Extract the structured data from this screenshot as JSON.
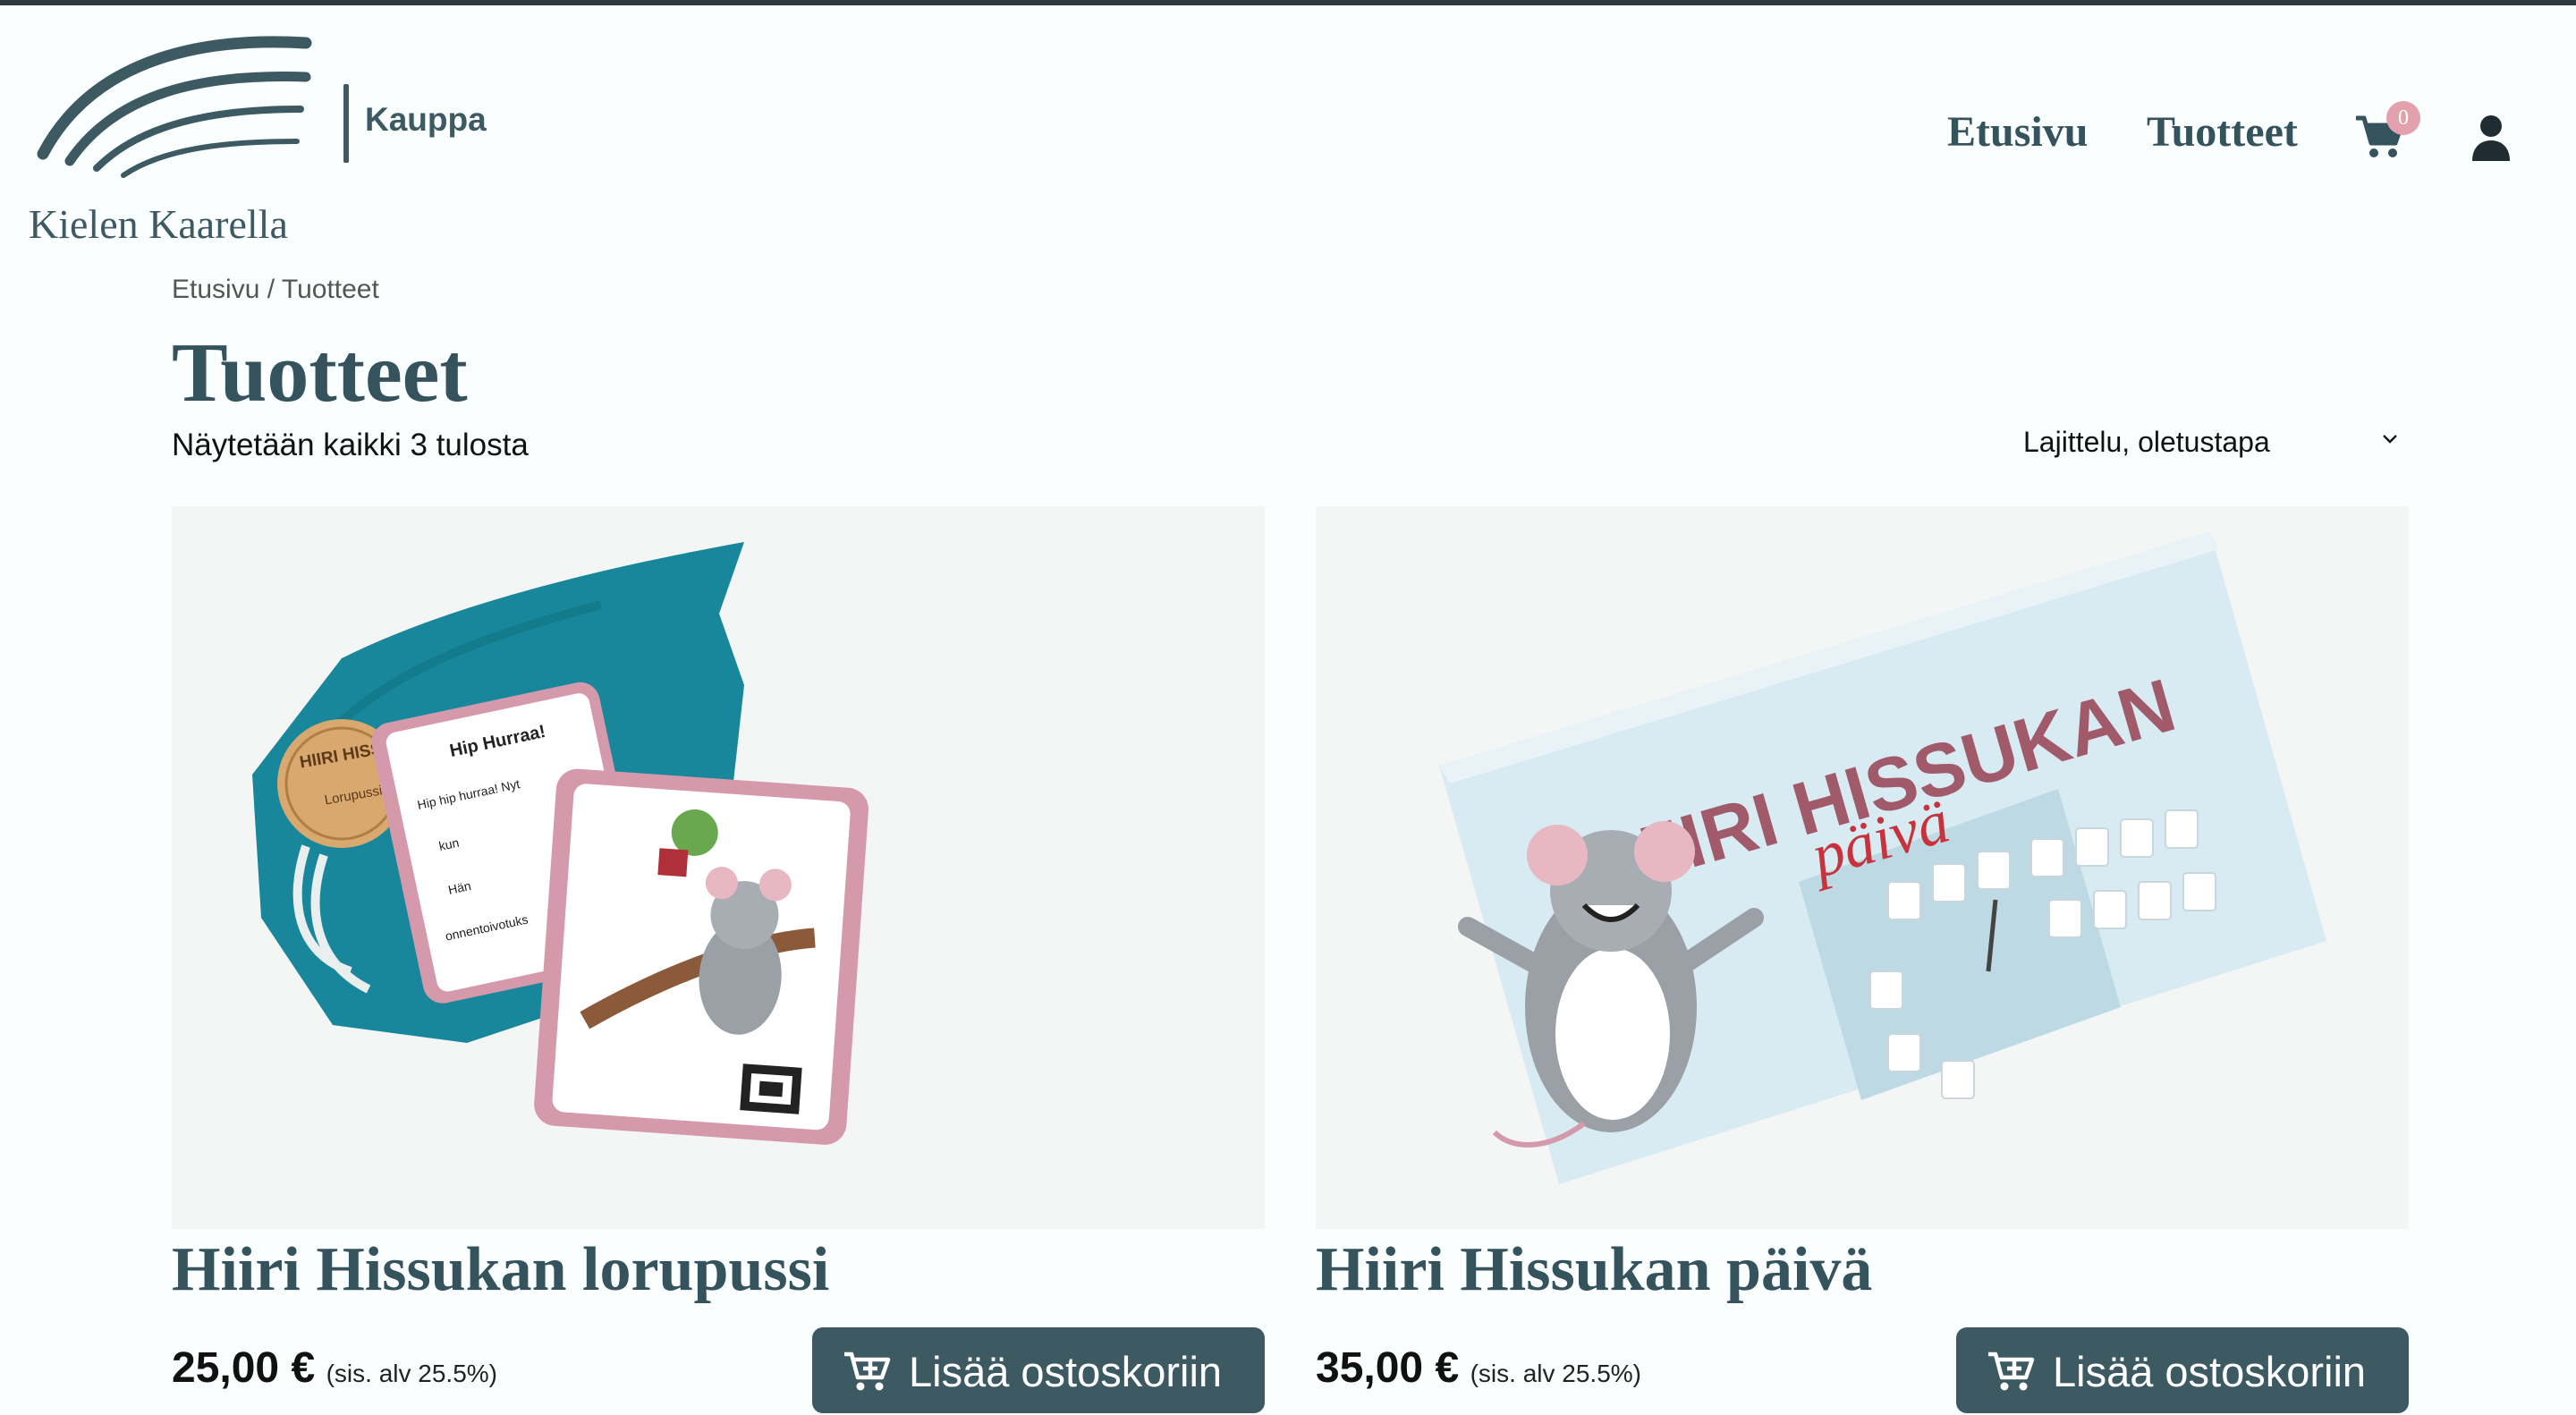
{
  "brand": {
    "logo_text": "Kielen Kaarella",
    "section": "Kauppa"
  },
  "nav": {
    "items": [
      "Etusivu",
      "Tuotteet"
    ],
    "cart_count": "0"
  },
  "breadcrumb": {
    "home": "Etusivu",
    "separator": " / ",
    "current": "Tuotteet"
  },
  "page": {
    "title": "Tuotteet",
    "result_count": "Näytetään kaikki 3 tulosta",
    "sort_selected": "Lajittelu, oletustapa"
  },
  "products": [
    {
      "title": "Hiiri Hissukan lorupussi",
      "price": "25,00 €",
      "vat": "(sis. alv 25.5%)",
      "button": "Lisää ostoskoriin",
      "image_text": {
        "coin": "HIIRI HISSUKAN",
        "coin_sub": "Lorupussi",
        "card_heading": "Hip Hurraa!",
        "card_line1": "Hip hip hurraa! Nyt",
        "card_line2": "kun",
        "card_line3": "Hän",
        "card_line4": "onnentoivotuks"
      }
    },
    {
      "title": "Hiiri Hissukan päivä",
      "price": "35,00 €",
      "vat": "(sis. alv 25.5%)",
      "button": "Lisää ostoskoriin",
      "image_text": {
        "box_title": "HIIRI HISSUKAN",
        "box_subtitle": "päivä"
      }
    }
  ],
  "colors": {
    "brand": "#3d5a63",
    "badge": "#e3a1ae",
    "background": "#fbfefe"
  },
  "icons": {
    "cart": "cart-icon",
    "account": "user-icon",
    "sort": "chevron-down-icon",
    "add": "cart-plus-icon"
  }
}
